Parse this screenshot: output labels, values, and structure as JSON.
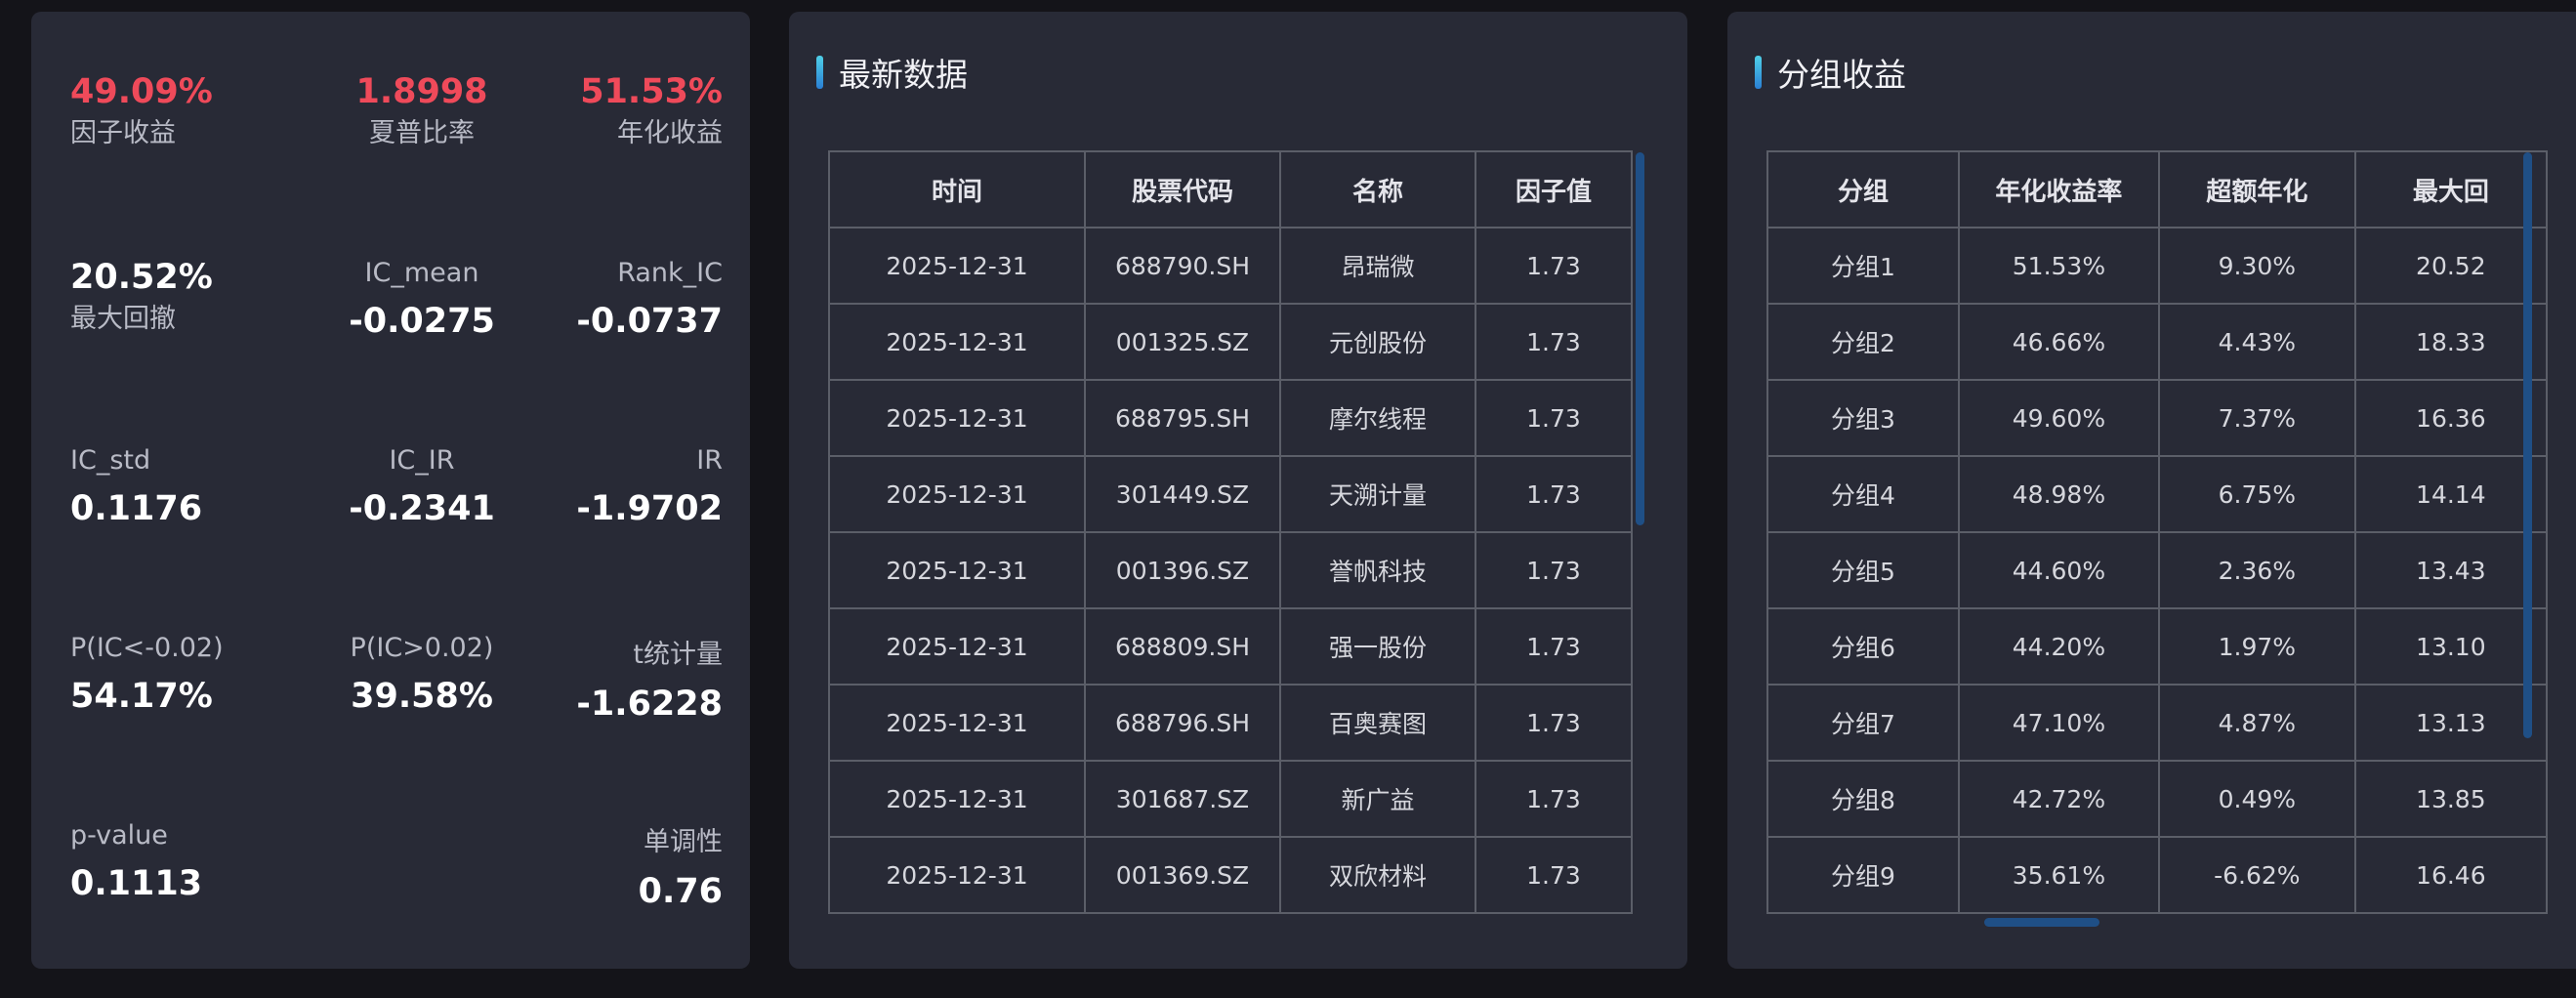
{
  "metrics": [
    {
      "label": "因子收益",
      "value": "49.09%",
      "value_color": "red",
      "label_top": false
    },
    {
      "label": "夏普比率",
      "value": "1.8998",
      "value_color": "red",
      "label_top": false
    },
    {
      "label": "年化收益",
      "value": "51.53%",
      "value_color": "red",
      "label_top": false
    },
    {
      "label": "最大回撤",
      "value": "20.52%",
      "value_color": "white",
      "label_top": false
    },
    {
      "label": "IC_mean",
      "value": "-0.0275",
      "value_color": "white",
      "label_top": true
    },
    {
      "label": "Rank_IC",
      "value": "-0.0737",
      "value_color": "white",
      "label_top": true
    },
    {
      "label": "IC_std",
      "value": "0.1176",
      "value_color": "white",
      "label_top": true
    },
    {
      "label": "IC_IR",
      "value": "-0.2341",
      "value_color": "white",
      "label_top": true
    },
    {
      "label": "IR",
      "value": "-1.9702",
      "value_color": "white",
      "label_top": true
    },
    {
      "label": "P(IC<-0.02)",
      "value": "54.17%",
      "value_color": "white",
      "label_top": true
    },
    {
      "label": "P(IC>0.02)",
      "value": "39.58%",
      "value_color": "white",
      "label_top": true
    },
    {
      "label": "t统计量",
      "value": "-1.6228",
      "value_color": "white",
      "label_top": true
    },
    {
      "label": "p-value",
      "value": "0.1113",
      "value_color": "white",
      "label_top": true
    },
    {
      "label": "",
      "value": "",
      "value_color": "white",
      "label_top": true
    },
    {
      "label": "单调性",
      "value": "0.76",
      "value_color": "white",
      "label_top": true
    }
  ],
  "latest": {
    "title": "最新数据",
    "columns": [
      "时间",
      "股票代码",
      "名称",
      "因子值"
    ],
    "rows": [
      [
        "2025-12-31",
        "688790.SH",
        "昂瑞微",
        "1.73"
      ],
      [
        "2025-12-31",
        "001325.SZ",
        "元创股份",
        "1.73"
      ],
      [
        "2025-12-31",
        "688795.SH",
        "摩尔线程",
        "1.73"
      ],
      [
        "2025-12-31",
        "301449.SZ",
        "天溯计量",
        "1.73"
      ],
      [
        "2025-12-31",
        "001396.SZ",
        "誉帆科技",
        "1.73"
      ],
      [
        "2025-12-31",
        "688809.SH",
        "强一股份",
        "1.73"
      ],
      [
        "2025-12-31",
        "688796.SH",
        "百奥赛图",
        "1.73"
      ],
      [
        "2025-12-31",
        "301687.SZ",
        "新广益",
        "1.73"
      ],
      [
        "2025-12-31",
        "001369.SZ",
        "双欣材料",
        "1.73"
      ]
    ]
  },
  "groups": {
    "title": "分组收益",
    "columns": [
      "分组",
      "年化收益率",
      "超额年化",
      "最大回"
    ],
    "rows": [
      [
        "分组1",
        "51.53%",
        "9.30%",
        "20.52"
      ],
      [
        "分组2",
        "46.66%",
        "4.43%",
        "18.33"
      ],
      [
        "分组3",
        "49.60%",
        "7.37%",
        "16.36"
      ],
      [
        "分组4",
        "48.98%",
        "6.75%",
        "14.14"
      ],
      [
        "分组5",
        "44.60%",
        "2.36%",
        "13.43"
      ],
      [
        "分组6",
        "44.20%",
        "1.97%",
        "13.10"
      ],
      [
        "分组7",
        "47.10%",
        "4.87%",
        "13.13"
      ],
      [
        "分组8",
        "42.72%",
        "0.49%",
        "13.85"
      ],
      [
        "分组9",
        "35.61%",
        "-6.62%",
        "16.46"
      ]
    ]
  },
  "colors": {
    "red": "#ef4a5a",
    "white": "#ffffff",
    "accent": "#2a7fd4"
  }
}
